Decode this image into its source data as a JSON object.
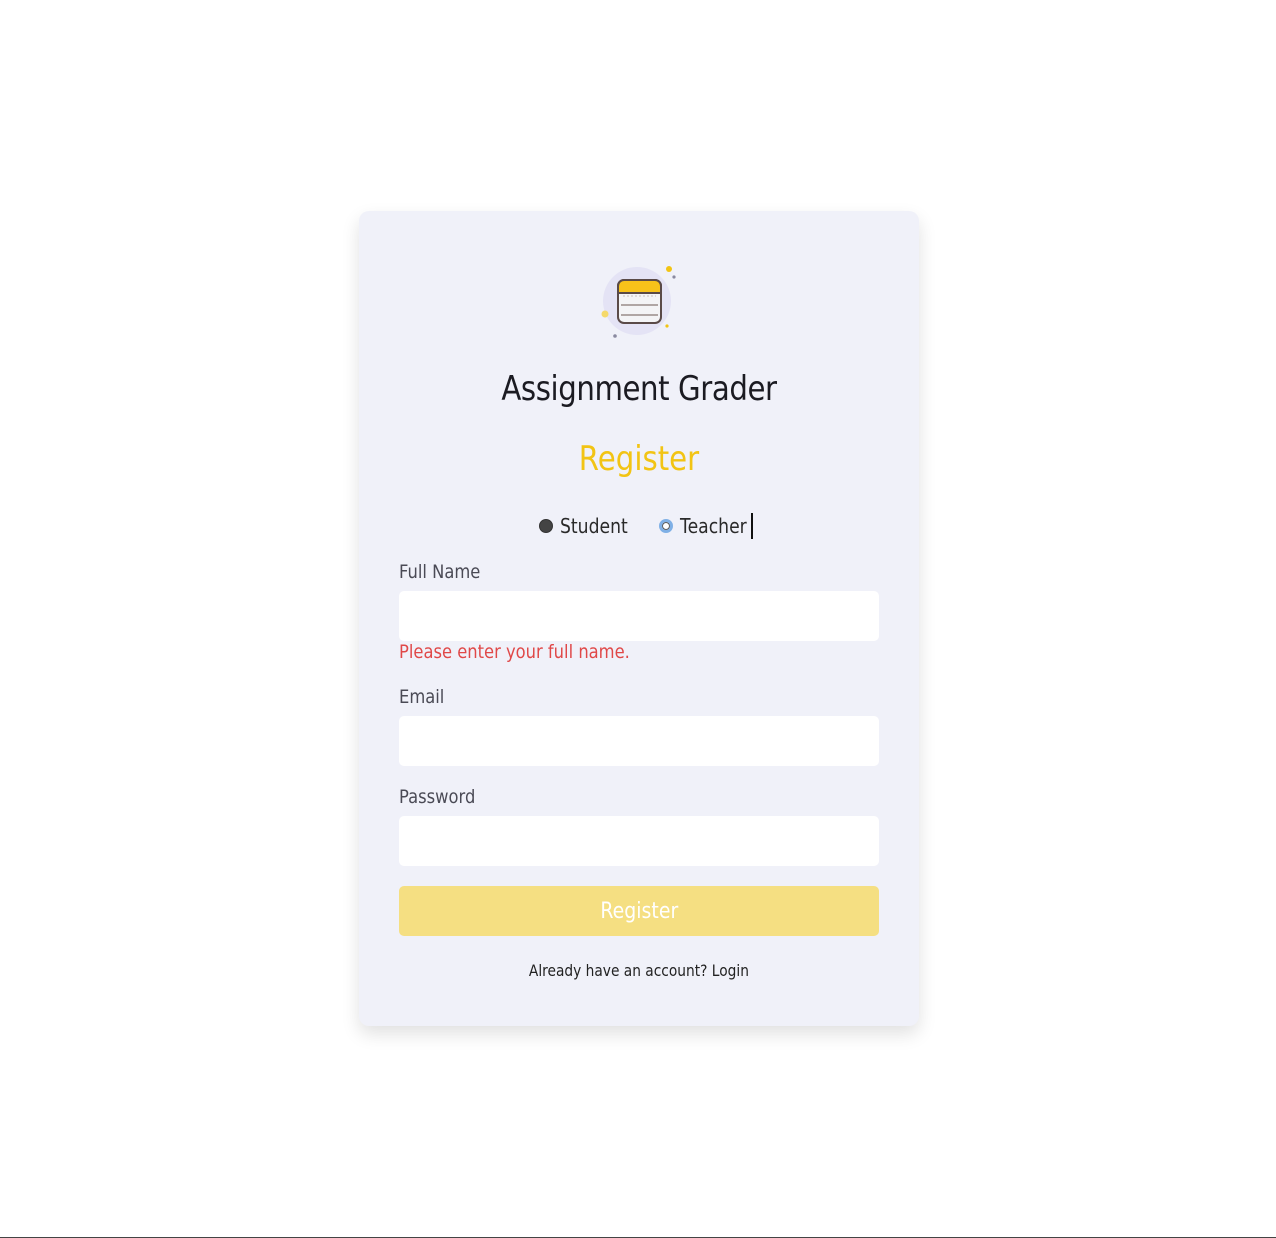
{
  "app": {
    "title": "Assignment Grader",
    "logo_icon": "notepad-icon"
  },
  "form": {
    "heading": "Register",
    "roles": [
      {
        "label": "Student",
        "checked": true
      },
      {
        "label": "Teacher",
        "checked": false
      }
    ],
    "fields": {
      "full_name": {
        "label": "Full Name",
        "value": "",
        "error": "Please enter your full name."
      },
      "email": {
        "label": "Email",
        "value": ""
      },
      "password": {
        "label": "Password",
        "value": ""
      }
    },
    "submit_label": "Register",
    "login_link": "Already have an account? Login"
  },
  "colors": {
    "accent": "#f2c414",
    "button": "#f5df82",
    "error": "#e04848",
    "card_bg": "#f0f1f9"
  }
}
